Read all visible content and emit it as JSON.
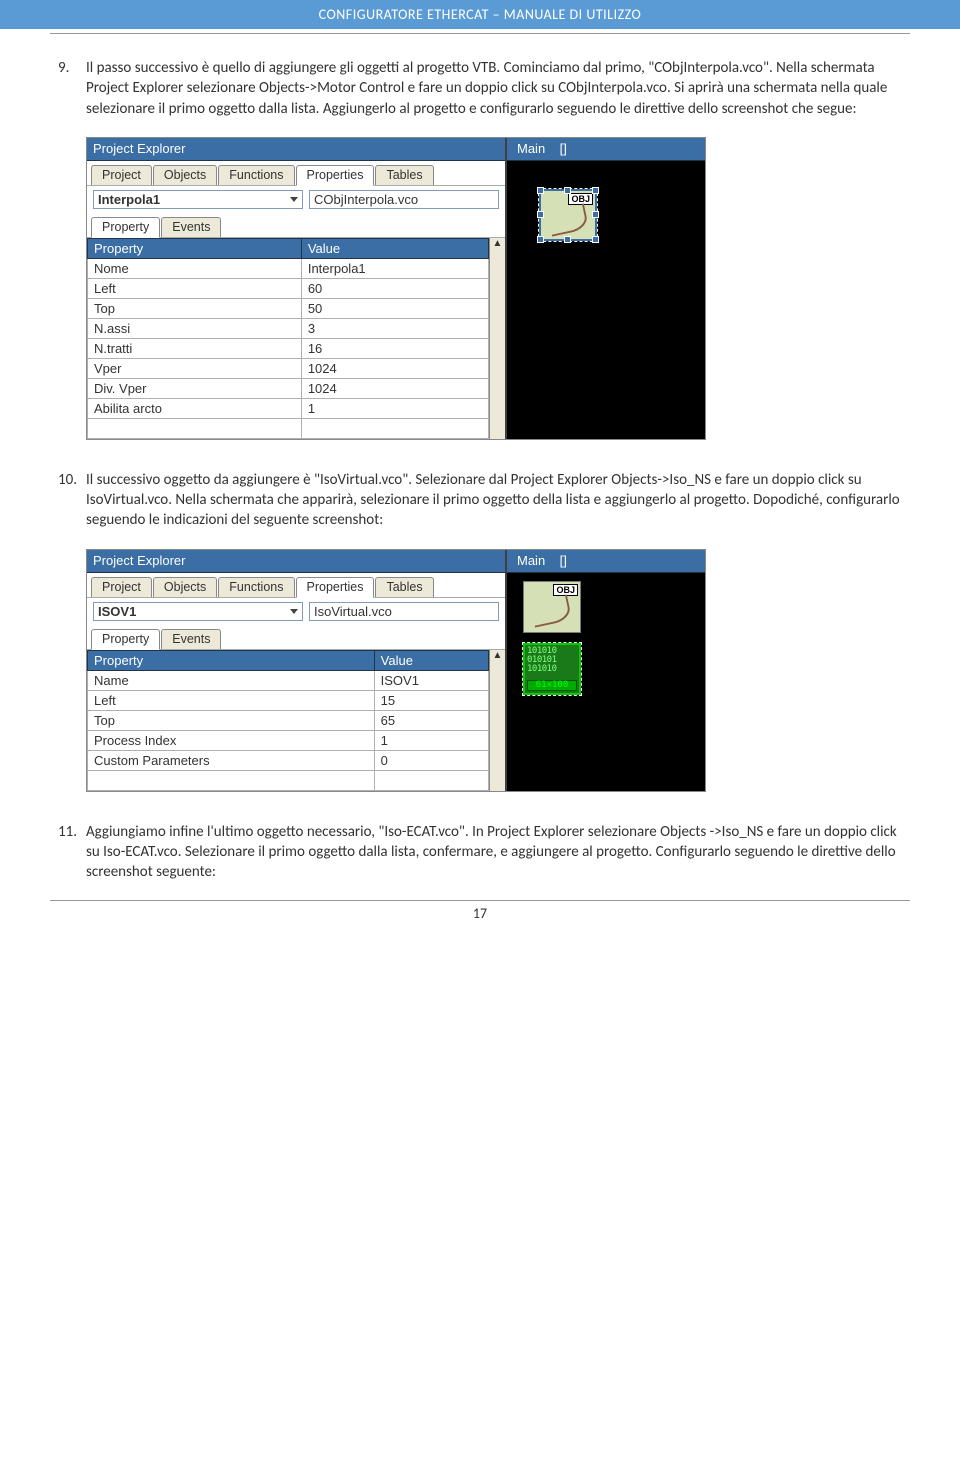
{
  "header": "CONFIGURATORE ETHERCAT – MANUALE DI UTILIZZO",
  "step9": {
    "num": "9.",
    "text": "Il passo successivo è quello di aggiungere gli oggetti al progetto VTB. Cominciamo dal primo, \"CObjInterpola.vco\". Nella schermata Project Explorer selezionare Objects->Motor Control e fare un doppio click su CObjInterpola.vco. Si aprirà una schermata nella quale selezionare il primo oggetto dalla lista. Aggiungerlo al progetto e configurarlo seguendo le direttive dello screenshot che segue:"
  },
  "step10": {
    "num": "10.",
    "text": "Il successivo oggetto da aggiungere è \"IsoVirtual.vco\". Selezionare dal Project Explorer Objects->Iso_NS e fare un doppio click su IsoVirtual.vco. Nella schermata che apparirà, selezionare il primo oggetto della lista e aggiungerlo al progetto. Dopodiché, configurarlo seguendo le indicazioni del seguente screenshot:"
  },
  "step11": {
    "num": "11.",
    "text": "Aggiungiamo infine l'ultimo oggetto necessario, \"Iso-ECAT.vco\". In Project Explorer selezionare Objects ->Iso_NS e fare un doppio click su Iso-ECAT.vco. Selezionare il primo oggetto dalla lista, confermare, e aggiungere al progetto. Configurarlo seguendo le direttive dello screenshot seguente:"
  },
  "ss1": {
    "leftTitle": "Project Explorer",
    "tabs": [
      "Project",
      "Objects",
      "Functions",
      "Properties",
      "Tables"
    ],
    "activeTab": 3,
    "objectName": "Interpola1",
    "className": "CObjInterpola.vco",
    "subTabs": [
      "Property",
      "Events"
    ],
    "activeSubTab": 0,
    "header": {
      "c1": "Property",
      "c2": "Value"
    },
    "rows": [
      {
        "p": "Nome",
        "v": "Interpola1"
      },
      {
        "p": "Left",
        "v": "60"
      },
      {
        "p": "Top",
        "v": "50"
      },
      {
        "p": "N.assi",
        "v": "3"
      },
      {
        "p": "N.tratti",
        "v": "16"
      },
      {
        "p": "Vper",
        "v": "1024"
      },
      {
        "p": "Div. Vper",
        "v": "1024"
      },
      {
        "p": "Abilita arcto",
        "v": "1"
      }
    ],
    "rightTitle": "Main",
    "rightSub": "[]",
    "canvasObjLabel": "OBJ"
  },
  "ss2": {
    "leftTitle": "Project Explorer",
    "tabs": [
      "Project",
      "Objects",
      "Functions",
      "Properties",
      "Tables"
    ],
    "activeTab": 3,
    "objectName": "ISOV1",
    "className": "IsoVirtual.vco",
    "subTabs": [
      "Property",
      "Events"
    ],
    "activeSubTab": 0,
    "header": {
      "c1": "Property",
      "c2": "Value"
    },
    "rows": [
      {
        "p": "Name",
        "v": "ISOV1"
      },
      {
        "p": "Left",
        "v": "15"
      },
      {
        "p": "Top",
        "v": "65"
      },
      {
        "p": "Process Index",
        "v": "1"
      },
      {
        "p": "Custom Parameters",
        "v": "0"
      }
    ],
    "rightTitle": "Main",
    "rightSub": "[]",
    "canvasObjLabel": "OBJ",
    "greenBits1": "101010",
    "greenBits2": "010101",
    "greenLbl": "61×100"
  },
  "pageNum": "17"
}
